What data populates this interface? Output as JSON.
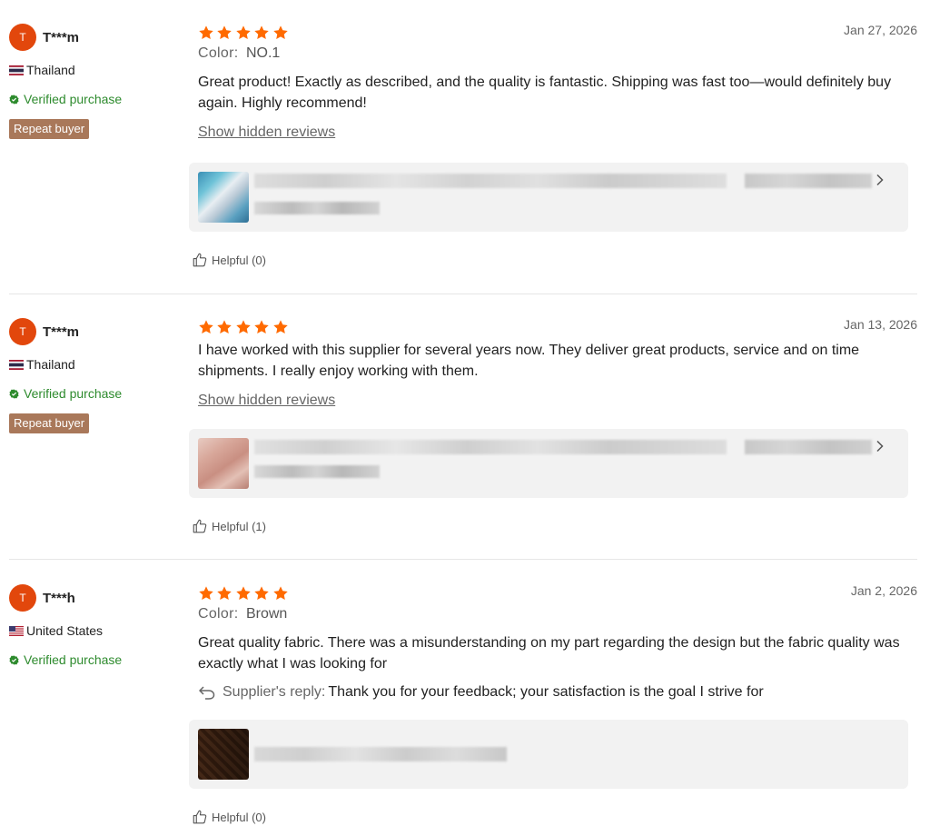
{
  "reviews": [
    {
      "user": {
        "initial": "T",
        "name": "T***m",
        "country": "Thailand",
        "flag": "thailand-flag",
        "verified": "Verified purchase",
        "badge": "Repeat buyer"
      },
      "rating": 5,
      "date": "Jan 27, 2026",
      "color_label": "Color:",
      "color_value": "NO.1",
      "text": "Great product! Exactly as described, and the quality is fantastic. Shipping was fast too—would definitely buy again. Highly recommend!",
      "show_hidden": "Show hidden reviews",
      "helpful": "Helpful (0)"
    },
    {
      "user": {
        "initial": "T",
        "name": "T***m",
        "country": "Thailand",
        "flag": "thailand-flag",
        "verified": "Verified purchase",
        "badge": "Repeat buyer"
      },
      "rating": 5,
      "date": "Jan 13, 2026",
      "text": "I have worked with this supplier for several years now. They deliver great products, service and on time shipments. I really enjoy working with them.",
      "show_hidden": "Show hidden reviews",
      "helpful": "Helpful (1)"
    },
    {
      "user": {
        "initial": "T",
        "name": "T***h",
        "country": "United States",
        "flag": "us-flag",
        "verified": "Verified purchase"
      },
      "rating": 5,
      "date": "Jan 2, 2026",
      "color_label": "Color:",
      "color_value": "Brown",
      "text": "Great quality fabric. There was a misunderstanding on my part regarding the design but the fabric quality was exactly what I was looking for",
      "reply_label": "Supplier's reply:",
      "reply_text": "Thank you for your feedback; your satisfaction is the goal I strive for",
      "helpful": "Helpful (0)"
    }
  ],
  "colors": {
    "accent": "#ff6a00",
    "avatar": "#e2470c",
    "verified": "#2e8b2e",
    "badge": "#a9785a"
  }
}
